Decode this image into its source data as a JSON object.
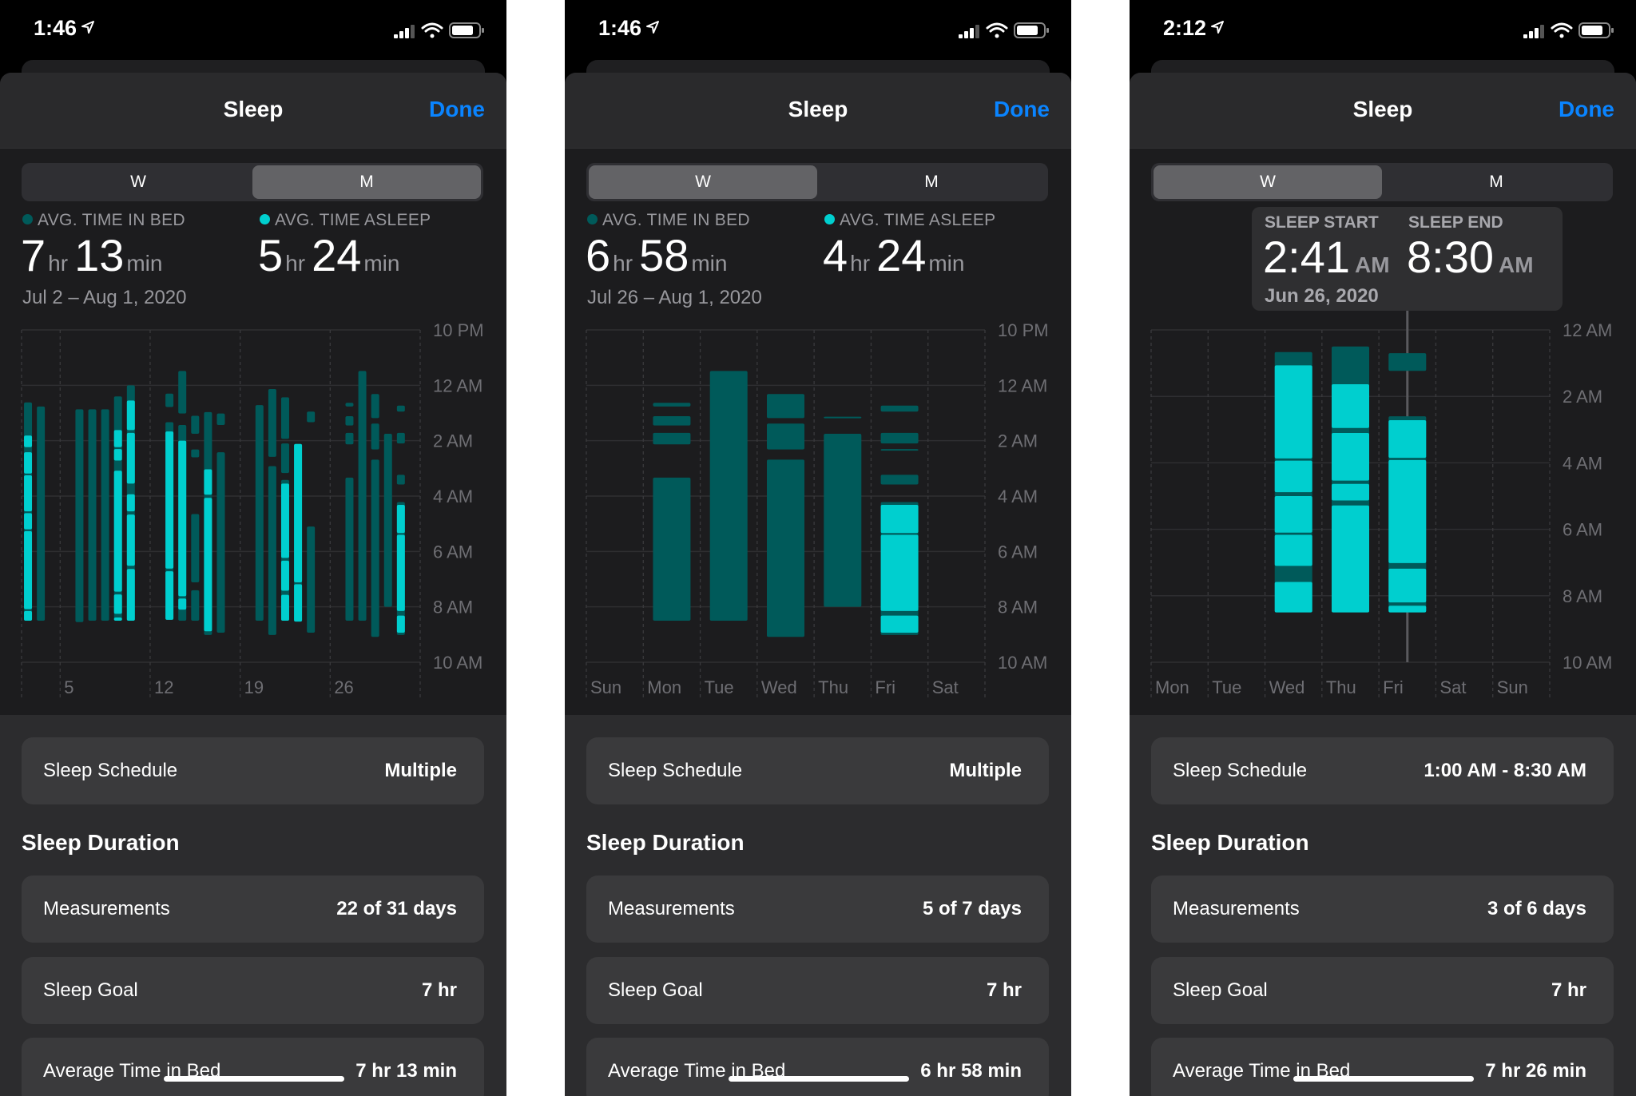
{
  "colors": {
    "in_bed": "#005a5a",
    "asleep": "#00cfcf",
    "accent": "#0a84ff"
  },
  "panels": [
    {
      "status": {
        "time": "1:46",
        "icons": [
          "location-arrow-icon",
          "signal-icon",
          "wifi-icon",
          "battery-icon"
        ]
      },
      "header": {
        "title": "Sleep",
        "done": "Done"
      },
      "segments": [
        "W",
        "M"
      ],
      "selected_segment": "M",
      "summary": {
        "in_bed": {
          "label": "AVG. TIME IN BED",
          "hr": "7",
          "hr_unit": "hr",
          "min": "13",
          "min_unit": "min"
        },
        "asleep": {
          "label": "AVG. TIME ASLEEP",
          "hr": "5",
          "hr_unit": "hr",
          "min": "24",
          "min_unit": "min"
        },
        "date_range": "Jul 2 – Aug 1, 2020"
      },
      "schedule": {
        "label": "Sleep Schedule",
        "value": "Multiple"
      },
      "duration": {
        "title": "Sleep Duration",
        "rows": [
          {
            "label": "Measurements",
            "value": "22 of 31 days"
          },
          {
            "label": "Sleep Goal",
            "value": "7 hr"
          },
          {
            "label": "Average Time in Bed",
            "value": "7 hr 13 min"
          }
        ]
      }
    },
    {
      "status": {
        "time": "1:46",
        "icons": [
          "location-arrow-icon",
          "signal-icon",
          "wifi-icon",
          "battery-icon"
        ]
      },
      "header": {
        "title": "Sleep",
        "done": "Done"
      },
      "segments": [
        "W",
        "M"
      ],
      "selected_segment": "W",
      "summary": {
        "in_bed": {
          "label": "AVG. TIME IN BED",
          "hr": "6",
          "hr_unit": "hr",
          "min": "58",
          "min_unit": "min"
        },
        "asleep": {
          "label": "AVG. TIME ASLEEP",
          "hr": "4",
          "hr_unit": "hr",
          "min": "24",
          "min_unit": "min"
        },
        "date_range": "Jul 26 – Aug 1, 2020"
      },
      "schedule": {
        "label": "Sleep Schedule",
        "value": "Multiple"
      },
      "duration": {
        "title": "Sleep Duration",
        "rows": [
          {
            "label": "Measurements",
            "value": "5 of 7 days"
          },
          {
            "label": "Sleep Goal",
            "value": "7 hr"
          },
          {
            "label": "Average Time in Bed",
            "value": "6 hr 58 min"
          }
        ]
      }
    },
    {
      "status": {
        "time": "2:12",
        "icons": [
          "location-arrow-icon",
          "signal-icon",
          "wifi-icon",
          "battery-icon"
        ]
      },
      "header": {
        "title": "Sleep",
        "done": "Done"
      },
      "segments": [
        "W",
        "M"
      ],
      "selected_segment": "W",
      "tooltip": {
        "start_label": "SLEEP START",
        "start_time": "2:41",
        "start_ampm": "AM",
        "end_label": "SLEEP END",
        "end_time": "8:30",
        "end_ampm": "AM",
        "date": "Jun 26, 2020",
        "selected_day": "Fri"
      },
      "schedule": {
        "label": "Sleep Schedule",
        "value": "1:00 AM - 8:30 AM"
      },
      "duration": {
        "title": "Sleep Duration",
        "rows": [
          {
            "label": "Measurements",
            "value": "3 of 6 days"
          },
          {
            "label": "Sleep Goal",
            "value": "7 hr"
          },
          {
            "label": "Average Time in Bed",
            "value": "7 hr 26 min"
          }
        ]
      }
    }
  ],
  "chart_data": [
    {
      "type": "range-bar",
      "y_range": [
        "22:00",
        "10:00"
      ],
      "y_ticks": [
        {
          "at": "22:00",
          "label": "10 PM"
        },
        {
          "at": "00:00",
          "label": "12 AM"
        },
        {
          "at": "02:00",
          "label": "2 AM"
        },
        {
          "at": "04:00",
          "label": "4 AM"
        },
        {
          "at": "06:00",
          "label": "6 AM"
        },
        {
          "at": "08:00",
          "label": "8 AM"
        },
        {
          "at": "10:00",
          "label": "10 AM"
        }
      ],
      "categories": [
        "Jul 2",
        "Jul 3",
        "Jul 4",
        "Jul 5",
        "Jul 6",
        "Jul 7",
        "Jul 8",
        "Jul 9",
        "Jul 10",
        "Jul 11",
        "Jul 12",
        "Jul 13",
        "Jul 14",
        "Jul 15",
        "Jul 16",
        "Jul 17",
        "Jul 18",
        "Jul 19",
        "Jul 20",
        "Jul 21",
        "Jul 22",
        "Jul 23",
        "Jul 24",
        "Jul 25",
        "Jul 26",
        "Jul 27",
        "Jul 28",
        "Jul 29",
        "Jul 30",
        "Jul 31",
        "Aug 1"
      ],
      "x_ticks": [
        {
          "at": "Jul 5",
          "label": "5"
        },
        {
          "at": "Jul 12",
          "label": "12"
        },
        {
          "at": "Jul 19",
          "label": "19"
        },
        {
          "at": "Jul 26",
          "label": "26"
        }
      ],
      "grid": true,
      "bars": [
        {
          "day": "Jul 2",
          "in_bed": [
            [
              "00:37",
              "08:30"
            ]
          ],
          "asleep": [
            [
              "01:49",
              "02:14"
            ],
            [
              "02:25",
              "03:11"
            ],
            [
              "03:15",
              "04:33"
            ],
            [
              "04:37",
              "05:12"
            ],
            [
              "05:16",
              "08:05"
            ],
            [
              "08:09",
              "08:30"
            ]
          ]
        },
        {
          "day": "Jul 3",
          "in_bed": [
            [
              "00:46",
              "08:30"
            ]
          ],
          "asleep": []
        },
        {
          "day": "Jul 6",
          "in_bed": [
            [
              "00:52",
              "08:33"
            ]
          ],
          "asleep": []
        },
        {
          "day": "Jul 7",
          "in_bed": [
            [
              "00:52",
              "08:30"
            ]
          ],
          "asleep": []
        },
        {
          "day": "Jul 8",
          "in_bed": [
            [
              "00:52",
              "08:30"
            ]
          ],
          "asleep": []
        },
        {
          "day": "Jul 9",
          "in_bed": [
            [
              "00:24",
              "08:30"
            ]
          ],
          "asleep": [
            [
              "01:37",
              "02:14"
            ],
            [
              "02:18",
              "02:43"
            ],
            [
              "03:05",
              "07:27"
            ],
            [
              "07:33",
              "08:15"
            ],
            [
              "08:23",
              "08:30"
            ]
          ]
        },
        {
          "day": "Jul 10",
          "in_bed": [
            [
              "00:00",
              "08:30"
            ]
          ],
          "asleep": [
            [
              "00:33",
              "01:37"
            ],
            [
              "01:43",
              "03:33"
            ],
            [
              "03:56",
              "04:33"
            ],
            [
              "04:40",
              "06:31"
            ],
            [
              "06:38",
              "08:30"
            ]
          ]
        },
        {
          "day": "Jul 13",
          "in_bed": [
            [
              "00:18",
              "00:47"
            ],
            [
              "01:20",
              "08:28"
            ]
          ],
          "asleep": [
            [
              "01:40",
              "06:37"
            ],
            [
              "06:43",
              "08:28"
            ]
          ]
        },
        {
          "day": "Jul 14",
          "in_bed": [
            [
              "23:29",
              "01:01"
            ],
            [
              "01:26",
              "08:30"
            ]
          ],
          "asleep": [
            [
              "02:00",
              "07:37"
            ],
            [
              "07:42",
              "08:06"
            ]
          ]
        },
        {
          "day": "Jul 15",
          "in_bed": [
            [
              "01:06",
              "01:45"
            ],
            [
              "02:19",
              "02:36"
            ],
            [
              "04:39",
              "07:07"
            ],
            [
              "07:24",
              "08:30"
            ]
          ],
          "asleep": []
        },
        {
          "day": "Jul 16",
          "in_bed": [
            [
              "00:58",
              "09:01"
            ]
          ],
          "asleep": [
            [
              "03:02",
              "03:57"
            ],
            [
              "04:04",
              "08:53"
            ]
          ]
        },
        {
          "day": "Jul 17",
          "in_bed": [
            [
              "01:01",
              "01:26"
            ],
            [
              "02:25",
              "08:56"
            ]
          ],
          "asleep": []
        },
        {
          "day": "Jul 20",
          "in_bed": [
            [
              "00:43",
              "08:30"
            ]
          ],
          "asleep": []
        },
        {
          "day": "Jul 21",
          "in_bed": [
            [
              "00:08",
              "02:35"
            ],
            [
              "02:55",
              "09:01"
            ]
          ],
          "asleep": []
        },
        {
          "day": "Jul 22",
          "in_bed": [
            [
              "00:26",
              "01:56"
            ],
            [
              "02:06",
              "03:10"
            ],
            [
              "03:25",
              "08:30"
            ]
          ],
          "asleep": [
            [
              "03:33",
              "06:14"
            ],
            [
              "06:20",
              "07:25"
            ],
            [
              "07:34",
              "08:30"
            ]
          ]
        },
        {
          "day": "Jul 23",
          "in_bed": [
            [
              "02:07",
              "08:32"
            ]
          ],
          "asleep": [
            [
              "02:07",
              "07:07"
            ],
            [
              "07:11",
              "08:32"
            ]
          ]
        },
        {
          "day": "Jul 24",
          "in_bed": [
            [
              "00:57",
              "01:20"
            ],
            [
              "05:06",
              "08:56"
            ]
          ],
          "asleep": []
        },
        {
          "day": "Jul 27",
          "in_bed": [
            [
              "00:38",
              "00:46"
            ],
            [
              "01:07",
              "01:27"
            ],
            [
              "01:43",
              "02:08"
            ],
            [
              "03:20",
              "08:30"
            ]
          ],
          "asleep": []
        },
        {
          "day": "Jul 28",
          "in_bed": [
            [
              "23:29",
              "08:30"
            ]
          ],
          "asleep": []
        },
        {
          "day": "Jul 29",
          "in_bed": [
            [
              "00:19",
              "01:11"
            ],
            [
              "01:23",
              "02:19"
            ],
            [
              "02:41",
              "09:05"
            ]
          ],
          "asleep": []
        },
        {
          "day": "Jul 30",
          "in_bed": [
            [
              "01:45",
              "08:00"
            ]
          ],
          "asleep": []
        },
        {
          "day": "Jul 31",
          "in_bed": [
            [
              "00:44",
              "00:57"
            ],
            [
              "01:43",
              "02:06"
            ],
            [
              "03:14",
              "03:35"
            ],
            [
              "04:13",
              "09:01"
            ]
          ],
          "asleep": [
            [
              "04:19",
              "05:20"
            ],
            [
              "05:24",
              "08:09"
            ],
            [
              "08:19",
              "08:56"
            ]
          ]
        }
      ]
    },
    {
      "type": "range-bar",
      "y_range": [
        "22:00",
        "10:00"
      ],
      "y_ticks": [
        {
          "at": "22:00",
          "label": "10 PM"
        },
        {
          "at": "00:00",
          "label": "12 AM"
        },
        {
          "at": "02:00",
          "label": "2 AM"
        },
        {
          "at": "04:00",
          "label": "4 AM"
        },
        {
          "at": "06:00",
          "label": "6 AM"
        },
        {
          "at": "08:00",
          "label": "8 AM"
        },
        {
          "at": "10:00",
          "label": "10 AM"
        }
      ],
      "categories": [
        "Sun",
        "Mon",
        "Tue",
        "Wed",
        "Thu",
        "Fri",
        "Sat"
      ],
      "grid": true,
      "bars": [
        {
          "day": "Mon",
          "in_bed": [
            [
              "00:38",
              "00:46"
            ],
            [
              "01:07",
              "01:27"
            ],
            [
              "01:43",
              "02:08"
            ],
            [
              "03:20",
              "08:30"
            ]
          ],
          "asleep": []
        },
        {
          "day": "Tue",
          "in_bed": [
            [
              "23:29",
              "08:30"
            ]
          ],
          "asleep": []
        },
        {
          "day": "Wed",
          "in_bed": [
            [
              "00:19",
              "01:11"
            ],
            [
              "01:23",
              "02:19"
            ],
            [
              "02:41",
              "09:05"
            ]
          ],
          "asleep": []
        },
        {
          "day": "Thu",
          "in_bed": [
            [
              "01:08",
              "01:09"
            ],
            [
              "01:45",
              "08:00"
            ]
          ],
          "asleep": []
        },
        {
          "day": "Fri",
          "in_bed": [
            [
              "00:44",
              "00:57"
            ],
            [
              "01:43",
              "02:06"
            ],
            [
              "02:18",
              "02:20"
            ],
            [
              "03:14",
              "03:35"
            ],
            [
              "04:13",
              "09:01"
            ]
          ],
          "asleep": [
            [
              "04:19",
              "05:20"
            ],
            [
              "05:24",
              "08:09"
            ],
            [
              "08:19",
              "08:56"
            ]
          ]
        }
      ]
    },
    {
      "type": "range-bar",
      "y_range": [
        "00:00",
        "10:00"
      ],
      "y_ticks": [
        {
          "at": "00:00",
          "label": "12 AM"
        },
        {
          "at": "02:00",
          "label": "2 AM"
        },
        {
          "at": "04:00",
          "label": "4 AM"
        },
        {
          "at": "06:00",
          "label": "6 AM"
        },
        {
          "at": "08:00",
          "label": "8 AM"
        },
        {
          "at": "10:00",
          "label": "10 AM"
        }
      ],
      "categories": [
        "Mon",
        "Tue",
        "Wed",
        "Thu",
        "Fri",
        "Sat",
        "Sun"
      ],
      "grid": true,
      "bars": [
        {
          "day": "Wed",
          "in_bed": [
            [
              "00:40",
              "08:30"
            ]
          ],
          "asleep": [
            [
              "01:04",
              "03:52"
            ],
            [
              "03:56",
              "04:53"
            ],
            [
              "05:00",
              "06:06"
            ],
            [
              "06:10",
              "07:06"
            ],
            [
              "07:35",
              "08:30"
            ]
          ]
        },
        {
          "day": "Thu",
          "in_bed": [
            [
              "00:30",
              "08:30"
            ]
          ],
          "asleep": [
            [
              "01:38",
              "02:57"
            ],
            [
              "03:06",
              "04:32"
            ],
            [
              "04:38",
              "05:08"
            ],
            [
              "05:17",
              "08:30"
            ]
          ]
        },
        {
          "day": "Fri",
          "in_bed": [
            [
              "00:42",
              "01:14"
            ],
            [
              "02:36",
              "08:30"
            ]
          ],
          "asleep": [
            [
              "02:43",
              "03:51"
            ],
            [
              "03:55",
              "07:01"
            ],
            [
              "07:11",
              "08:12"
            ],
            [
              "08:18",
              "08:30"
            ]
          ]
        }
      ]
    }
  ]
}
